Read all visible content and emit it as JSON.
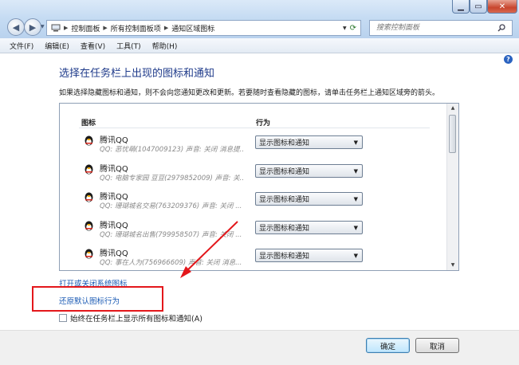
{
  "titlebar": {
    "caption_buttons": [
      "minimize",
      "maximize",
      "close"
    ]
  },
  "address_bar": {
    "segments": [
      "控制面板",
      "所有控制面板项",
      "通知区域图标"
    ]
  },
  "search": {
    "placeholder": "搜索控制面板"
  },
  "menu": {
    "items": [
      "文件(F)",
      "编辑(E)",
      "查看(V)",
      "工具(T)",
      "帮助(H)"
    ]
  },
  "main": {
    "heading": "选择在任务栏上出现的图标和通知",
    "description": "如果选择隐藏图标和通知，则不会向您通知更改和更新。若要随时查看隐藏的图标，请单击任务栏上通知区域旁的箭头。",
    "columns": {
      "icon": "图标",
      "behavior": "行为"
    },
    "rows": [
      {
        "name": "腾讯QQ",
        "detail": "QQ: 恶忧萌(1047009123)  声音: 关闭  消息提...",
        "behavior": "显示图标和通知"
      },
      {
        "name": "腾讯QQ",
        "detail": "QQ: 电脑专家园 豆豆(2979852009)  声音: 关...",
        "behavior": "显示图标和通知"
      },
      {
        "name": "腾讯QQ",
        "detail": "QQ: 珊瑚城名交易(763209376)  声音: 关闭 ...",
        "behavior": "显示图标和通知"
      },
      {
        "name": "腾讯QQ",
        "detail": "QQ: 珊瑚城名出售(799958507)  声音: 关闭 ...",
        "behavior": "显示图标和通知"
      },
      {
        "name": "腾讯QQ",
        "detail": "QQ: 事在人为(756966609)  声音: 关闭  消息...",
        "behavior": "显示图标和通知"
      }
    ],
    "link_system_icons": "打开或关闭系统图标",
    "link_restore": "还原默认图标行为",
    "always_show_label": "始终在任务栏上显示所有图标和通知(A)",
    "always_show_checked": false
  },
  "footer": {
    "ok": "确定",
    "cancel": "取消"
  },
  "colors": {
    "annotation_red": "#e3171b",
    "link_blue": "#1a5ab4",
    "heading_blue": "#1e3a8a"
  }
}
